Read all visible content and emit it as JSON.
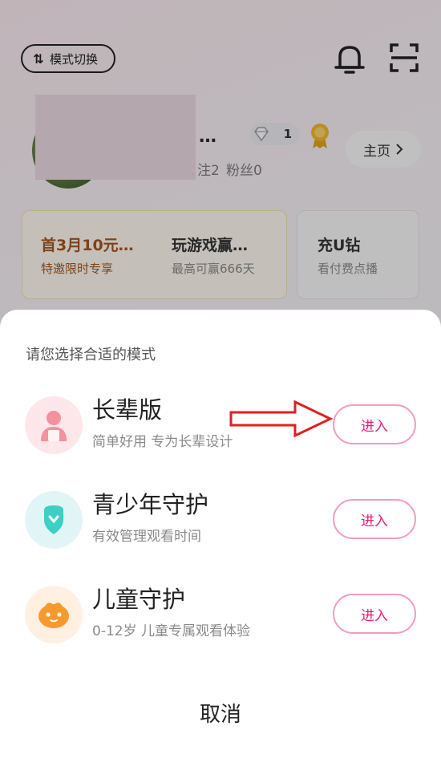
{
  "background_page": {
    "mode_switch_label": "模式切换",
    "name_truncated": "…",
    "stats_fragment": "注2",
    "fans": "粉丝0",
    "diamond_level": "1",
    "homepage_label": "主页",
    "promos": [
      {
        "title": "首3月10元…",
        "subtitle": "特邀限时专享"
      },
      {
        "title": "玩游戏赢…",
        "subtitle": "最高可赢666天"
      },
      {
        "title": "充U钻",
        "subtitle": "看付费点播"
      }
    ]
  },
  "sheet": {
    "title": "请您选择合适的模式",
    "modes": [
      {
        "name": "长辈版",
        "desc": "简单好用 专为长辈设计",
        "button": "进入",
        "icon": "elder-person-icon"
      },
      {
        "name": "青少年守护",
        "desc": "有效管理观看时间",
        "button": "进入",
        "icon": "teen-shield-icon"
      },
      {
        "name": "儿童守护",
        "desc": "0-12岁 儿童专属观看体验",
        "button": "进入",
        "icon": "child-face-icon"
      }
    ],
    "cancel": "取消"
  },
  "colors": {
    "accent_pink": "#e4207b",
    "button_border": "#f39bc0",
    "annotation_red": "#e02020"
  }
}
